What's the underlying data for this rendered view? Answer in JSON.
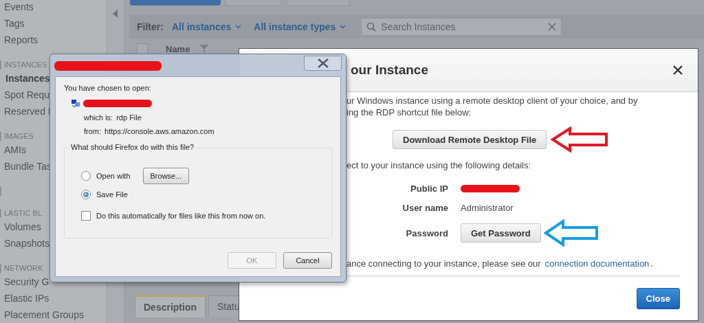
{
  "sidebar": {
    "items": [
      {
        "kind": "item",
        "label": "Events",
        "selected": false
      },
      {
        "kind": "item",
        "label": "Tags",
        "selected": false
      },
      {
        "kind": "item",
        "label": "Reports",
        "selected": false
      },
      {
        "kind": "header",
        "label": "INSTANCES"
      },
      {
        "kind": "item",
        "label": "Instances",
        "selected": true
      },
      {
        "kind": "item",
        "label": "Spot Requ",
        "selected": false
      },
      {
        "kind": "item",
        "label": "Reserved I",
        "selected": false
      },
      {
        "kind": "header",
        "label": "IMAGES"
      },
      {
        "kind": "item",
        "label": "AMIs",
        "selected": false
      },
      {
        "kind": "item",
        "label": "Bundle Tas",
        "selected": false
      },
      {
        "kind": "header"
      },
      {
        "kind": "header",
        "label": "LASTIC BL"
      },
      {
        "kind": "item",
        "label": "Volumes",
        "selected": false
      },
      {
        "kind": "item",
        "label": "Snapshots",
        "selected": false
      },
      {
        "kind": "header",
        "label": "NETWORK"
      },
      {
        "kind": "item",
        "label": "Security G",
        "selected": false
      },
      {
        "kind": "item",
        "label": "Elastic IPs",
        "selected": false
      },
      {
        "kind": "item",
        "label": "Placement Groups",
        "selected": false
      }
    ]
  },
  "console": {
    "filter_label": "Filter:",
    "filters": [
      "All instances",
      "All instance types"
    ],
    "search": {
      "placeholder": "Search Instances"
    },
    "table": {
      "select_all": {
        "checked": false
      },
      "columns": [
        "Name"
      ]
    },
    "detail_tabs": [
      {
        "label": "Description",
        "selected": true
      },
      {
        "label": "Statu",
        "selected": false
      }
    ]
  },
  "connect_modal": {
    "title": "our Instance",
    "intro_lines": [
      "ur Windows instance using a remote desktop client of your choice, and by",
      "ing the RDP shortcut file below:"
    ],
    "download_button": "Download Remote Desktop File",
    "details_intro": "ect to your instance using the following details:",
    "details": [
      {
        "kind": "redacted",
        "label": "Public IP"
      },
      {
        "kind": "text",
        "label": "User name",
        "value": "Administrator"
      },
      {
        "kind": "button",
        "label": "Password",
        "value": "Get Password"
      }
    ],
    "help_text": "ance connecting to your instance, please see our",
    "help_link": "connection documentation",
    "help_end": ".",
    "close_button": "Close"
  },
  "download_dialog": {
    "prompt": "You have chosen to open:",
    "type_label": "which is:",
    "type": "rdp File",
    "from_label": "from:",
    "from": "https://console.aws.amazon.com",
    "question": "What should Firefox do with this file?",
    "options": [
      {
        "label": "Open with",
        "selected": false,
        "button": "Browse..."
      },
      {
        "label": "Save File",
        "selected": true
      }
    ],
    "auto": {
      "label": "Do this automatically for files like this from now on.",
      "checked": false
    },
    "buttons": [
      {
        "label": "OK",
        "disabled": true
      },
      {
        "label": "Cancel",
        "disabled": false
      }
    ]
  }
}
